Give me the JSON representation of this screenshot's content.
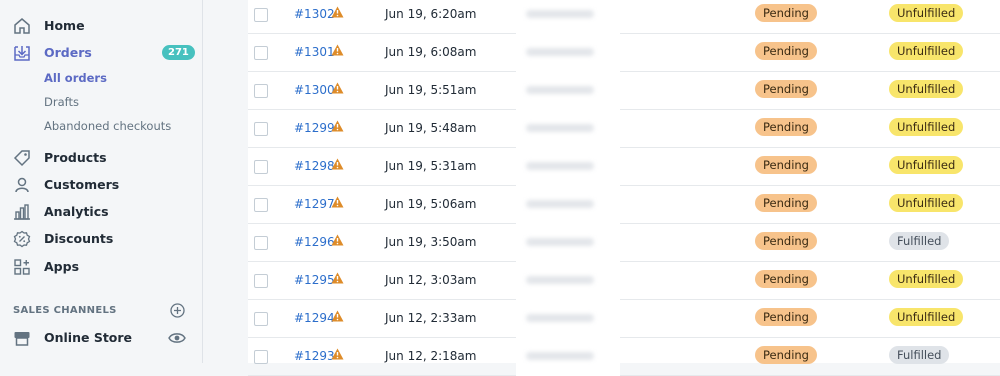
{
  "sidebar": {
    "home": "Home",
    "orders": "Orders",
    "orders_count": "271",
    "all_orders": "All orders",
    "drafts": "Drafts",
    "abandoned": "Abandoned checkouts",
    "products": "Products",
    "customers": "Customers",
    "analytics": "Analytics",
    "discounts": "Discounts",
    "apps": "Apps",
    "sales_channels": "SALES CHANNELS",
    "online_store": "Online Store"
  },
  "orders": [
    {
      "id": "#1302",
      "date": "Jun 19, 6:20am",
      "payment": "Pending",
      "fulfillment": "Unfulfilled"
    },
    {
      "id": "#1301",
      "date": "Jun 19, 6:08am",
      "payment": "Pending",
      "fulfillment": "Unfulfilled"
    },
    {
      "id": "#1300",
      "date": "Jun 19, 5:51am",
      "payment": "Pending",
      "fulfillment": "Unfulfilled"
    },
    {
      "id": "#1299",
      "date": "Jun 19, 5:48am",
      "payment": "Pending",
      "fulfillment": "Unfulfilled"
    },
    {
      "id": "#1298",
      "date": "Jun 19, 5:31am",
      "payment": "Pending",
      "fulfillment": "Unfulfilled"
    },
    {
      "id": "#1297",
      "date": "Jun 19, 5:06am",
      "payment": "Pending",
      "fulfillment": "Unfulfilled"
    },
    {
      "id": "#1296",
      "date": "Jun 19, 3:50am",
      "payment": "Pending",
      "fulfillment": "Fulfilled"
    },
    {
      "id": "#1295",
      "date": "Jun 12, 3:03am",
      "payment": "Pending",
      "fulfillment": "Unfulfilled"
    },
    {
      "id": "#1294",
      "date": "Jun 12, 2:33am",
      "payment": "Pending",
      "fulfillment": "Unfulfilled"
    },
    {
      "id": "#1293",
      "date": "Jun 12, 2:18am",
      "payment": "Pending",
      "fulfillment": "Fulfilled"
    }
  ]
}
